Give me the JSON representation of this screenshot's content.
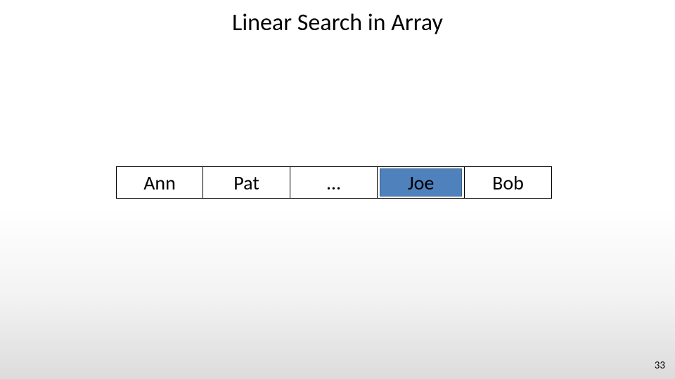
{
  "title": "Linear Search in Array",
  "array": {
    "cells": [
      {
        "label": "Ann",
        "highlight": false
      },
      {
        "label": "Pat",
        "highlight": false
      },
      {
        "label": "…",
        "highlight": false
      },
      {
        "label": "Joe",
        "highlight": true
      },
      {
        "label": "Bob",
        "highlight": false
      }
    ]
  },
  "page_number": "33"
}
